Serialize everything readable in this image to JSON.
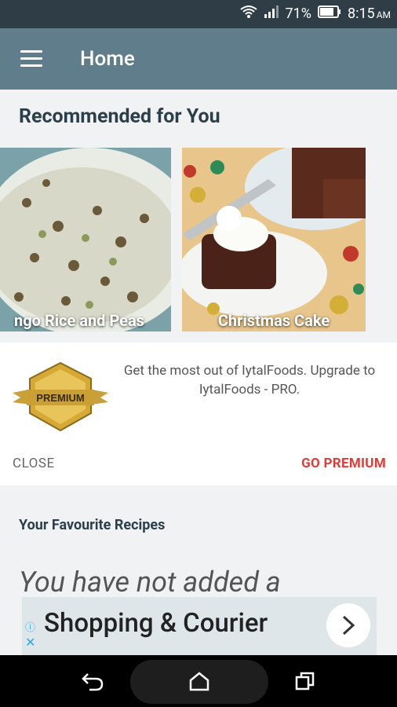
{
  "status_bar": {
    "battery": "71%",
    "time": "8:15",
    "ampm": "AM"
  },
  "appbar": {
    "title": "Home"
  },
  "recommended": {
    "title": "Recommended for You",
    "items": [
      {
        "label": "ngo Rice and Peas"
      },
      {
        "label": "Christmas Cake"
      }
    ]
  },
  "promo": {
    "badge_text": "PREMIUM",
    "message": "Get the most out of IytalFoods. Upgrade to IytalFoods - PRO.",
    "close_label": "CLOSE",
    "go_premium_label": "GO PREMIUM"
  },
  "favourites": {
    "title": "Your Favourite Recipes",
    "empty_text": "You have not added a"
  },
  "ad": {
    "text": "Shopping & Courier"
  },
  "colors": {
    "appbar": "#607d8b",
    "accent": "#e53935",
    "title_text": "#2b3f4b"
  }
}
